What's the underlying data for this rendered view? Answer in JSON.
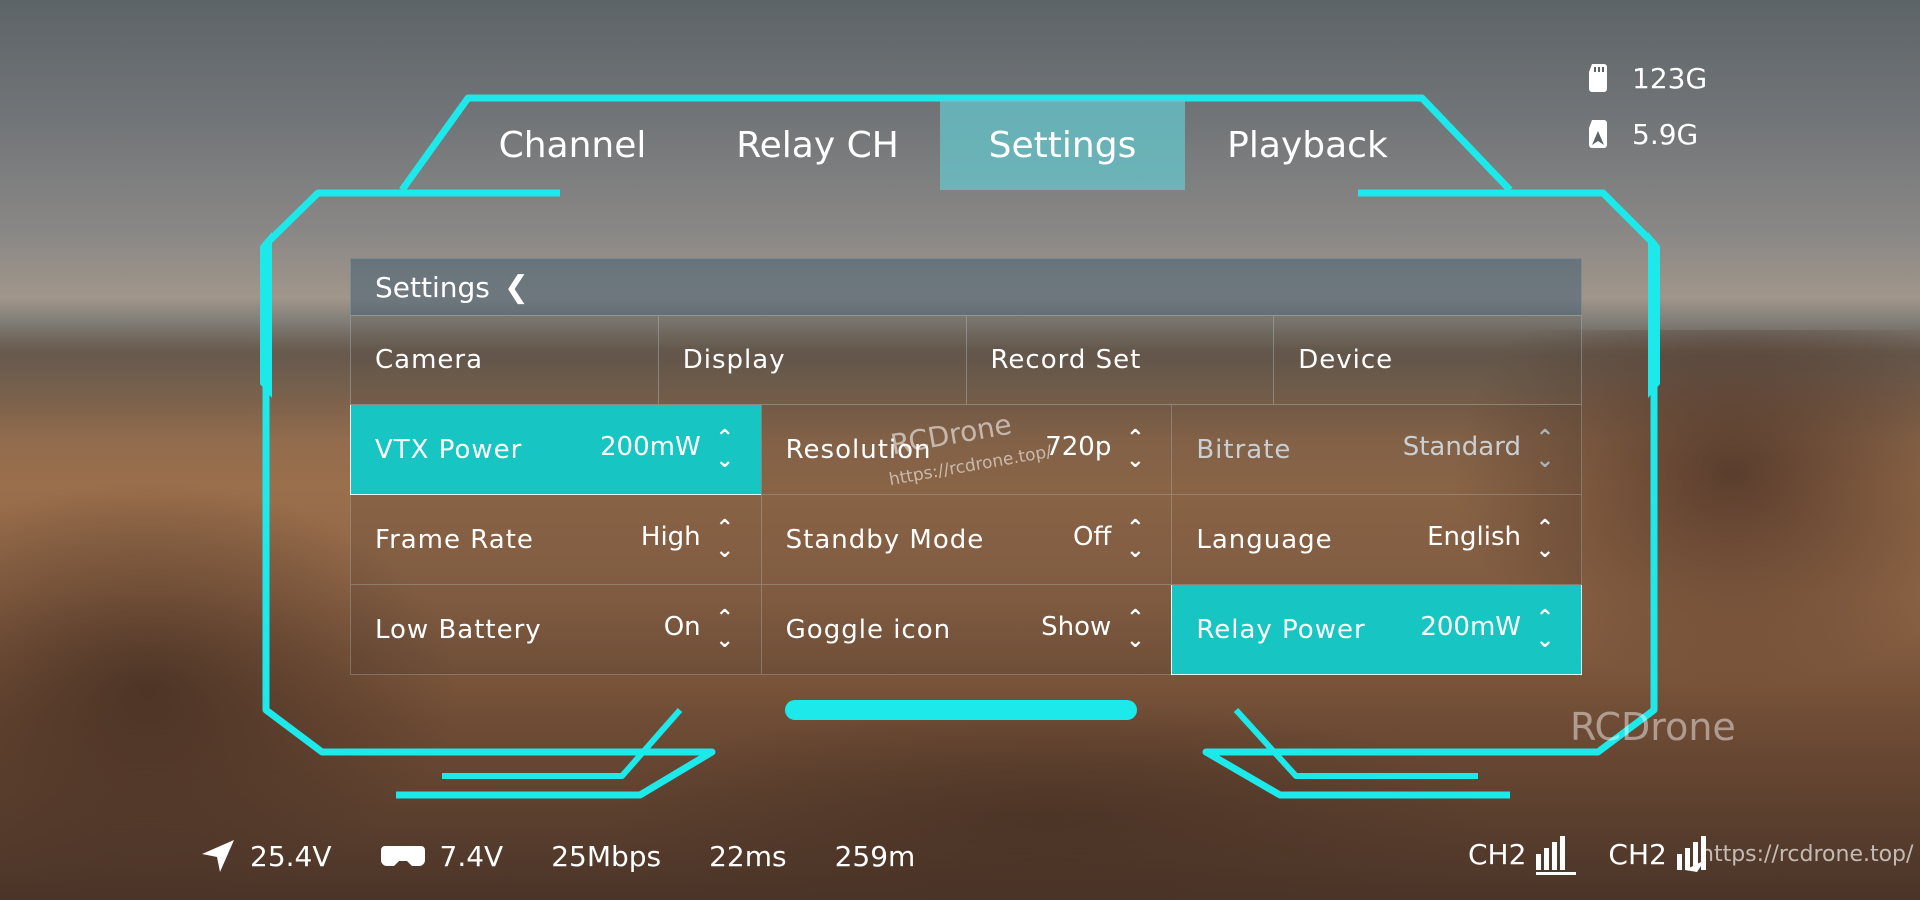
{
  "tabs": [
    {
      "label": "Channel",
      "active": false
    },
    {
      "label": "Relay CH",
      "active": false
    },
    {
      "label": "Settings",
      "active": true
    },
    {
      "label": "Playback",
      "active": false
    }
  ],
  "storage": {
    "card1": "123G",
    "card2": "5.9G"
  },
  "panel": {
    "title": "Settings",
    "back_icon": "chevron-left-icon",
    "subtabs": [
      "Camera",
      "Display",
      "Record Set",
      "Device"
    ],
    "settings": [
      {
        "label": "VTX Power",
        "value": "200mW",
        "active": true
      },
      {
        "label": "Resolution",
        "value": "720p"
      },
      {
        "label": "Bitrate",
        "value": "Standard",
        "disabled": true
      },
      {
        "label": "Frame Rate",
        "value": "High"
      },
      {
        "label": "Standby Mode",
        "value": "Off"
      },
      {
        "label": "Language",
        "value": "English"
      },
      {
        "label": "Low Battery",
        "value": "On"
      },
      {
        "label": "Goggle icon",
        "value": "Show"
      },
      {
        "label": "Relay Power",
        "value": "200mW",
        "active": true
      }
    ]
  },
  "status_bar": {
    "drone_voltage": "25.4V",
    "goggle_voltage": "7.4V",
    "bitrate": "25Mbps",
    "latency": "22ms",
    "distance": "259m",
    "ch_main": "CH2",
    "ch_relay": "CH2"
  },
  "watermarks": {
    "brand": "RCDrone",
    "url": "https://rcdrone.top/",
    "center_brand": "RCDrone",
    "center_url": "https://rcdrone.top/"
  },
  "colors": {
    "accent": "#1de8ea",
    "active_cell": "#17c6c3"
  }
}
